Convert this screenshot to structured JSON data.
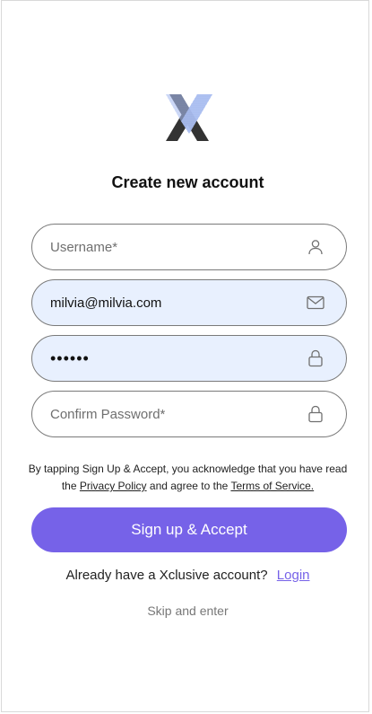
{
  "header": {
    "title": "Create new account",
    "logo_icon": "xclusive-x-logo",
    "brand_colors": {
      "mark_dark": "#333333",
      "mark_accent": "#6f8fe6"
    }
  },
  "form": {
    "username": {
      "placeholder": "Username*",
      "value": "",
      "icon": "user-icon"
    },
    "email": {
      "placeholder": "",
      "value": "milvia@milvia.com",
      "icon": "mail-icon"
    },
    "password": {
      "placeholder": "",
      "value": "••••••",
      "icon": "lock-icon"
    },
    "confirm_password": {
      "placeholder": "Confirm Password*",
      "value": "",
      "icon": "lock-icon"
    }
  },
  "terms": {
    "prefix": "By tapping Sign Up & Accept, you acknowledge that you have read the",
    "privacy_label": "Privacy Policy",
    "middle": "and agree to the",
    "terms_label": "Terms of Service."
  },
  "actions": {
    "signup_label": "Sign up & Accept",
    "already_text": "Already have a Xclusive account?",
    "login_label": "Login",
    "skip_label": "Skip and enter"
  },
  "colors": {
    "accent": "#7662e8",
    "autofill_bg": "#e8f0fe",
    "border": "#7a7a7a"
  }
}
